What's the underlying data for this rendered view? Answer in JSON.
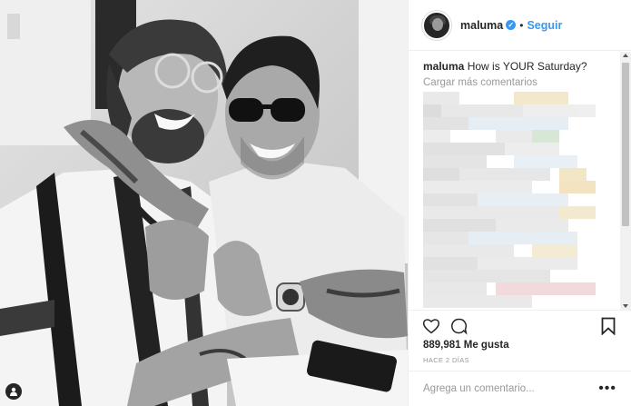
{
  "post": {
    "image_alt": "Black and white photo of two smiling men embracing",
    "tag_icon": "person-tag-icon"
  },
  "header": {
    "username": "maluma",
    "verified_icon": "verified-badge-icon",
    "separator": "•",
    "follow_label": "Seguir"
  },
  "comments": {
    "caption_user": "maluma",
    "caption_text": "How is YOUR Saturday?",
    "load_more": "Cargar más comentarios"
  },
  "actions": {
    "like_icon": "heart-icon",
    "comment_icon": "comment-bubble-icon",
    "save_icon": "bookmark-icon"
  },
  "likes_text": "889,981 Me gusta",
  "time_text": "HACE 2 DÍAS",
  "add_comment": {
    "placeholder": "Agrega un comentario...",
    "more_label": "•••"
  },
  "colors": {
    "accent": "#3897f0",
    "text": "#262626",
    "muted": "#999999",
    "border": "#efefef"
  }
}
